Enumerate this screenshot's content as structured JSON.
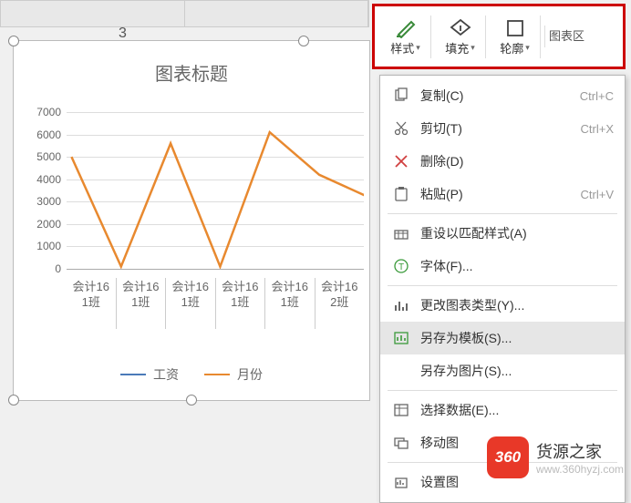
{
  "header": {
    "col_label": "3"
  },
  "toolbar": {
    "style_label": "样式",
    "fill_label": "填充",
    "outline_label": "轮廓",
    "chart_area_label": "图表区"
  },
  "chart": {
    "title": "图表标题",
    "legend": [
      "工资",
      "月份"
    ],
    "colors": {
      "salary": "#4a7ab8",
      "month": "#e8892f"
    }
  },
  "chart_data": {
    "type": "line",
    "title": "图表标题",
    "xlabel": "",
    "ylabel": "",
    "ylim": [
      0,
      7000
    ],
    "y_ticks": [
      0,
      1000,
      2000,
      3000,
      4000,
      5000,
      6000,
      7000
    ],
    "categories": [
      "会计161班",
      "会计161班",
      "会计161班",
      "会计161班",
      "会计161班",
      "会计162班"
    ],
    "series": [
      {
        "name": "工资",
        "values": [
          null,
          null,
          null,
          null,
          null,
          null
        ]
      },
      {
        "name": "月份",
        "values": [
          5000,
          100,
          5600,
          100,
          6100,
          4200
        ]
      }
    ],
    "legend_position": "bottom",
    "grid": true
  },
  "context_menu": {
    "items": [
      {
        "icon": "copy-icon",
        "label": "复制(C)",
        "shortcut": "Ctrl+C"
      },
      {
        "icon": "cut-icon",
        "label": "剪切(T)",
        "shortcut": "Ctrl+X"
      },
      {
        "icon": "delete-icon",
        "label": "删除(D)",
        "shortcut": ""
      },
      {
        "icon": "paste-icon",
        "label": "粘贴(P)",
        "shortcut": "Ctrl+V"
      },
      {
        "icon": "reset-icon",
        "label": "重设以匹配样式(A)",
        "shortcut": "",
        "sep_before": true
      },
      {
        "icon": "font-icon",
        "label": "字体(F)...",
        "shortcut": ""
      },
      {
        "icon": "change-chart-icon",
        "label": "更改图表类型(Y)...",
        "shortcut": "",
        "sep_before": true
      },
      {
        "icon": "save-template-icon",
        "label": "另存为模板(S)...",
        "shortcut": "",
        "highlight": true
      },
      {
        "icon": "save-image-icon",
        "label": "另存为图片(S)...",
        "shortcut": ""
      },
      {
        "icon": "select-data-icon",
        "label": "选择数据(E)...",
        "shortcut": "",
        "sep_before": true
      },
      {
        "icon": "move-chart-icon",
        "label": "移动图",
        "shortcut": ""
      },
      {
        "icon": "format-chart-icon",
        "label": "设置图",
        "shortcut": "",
        "sep_before": true
      }
    ]
  },
  "watermark": {
    "badge": "360",
    "title": "货源之家",
    "sub": "www.360hyzj.com"
  }
}
